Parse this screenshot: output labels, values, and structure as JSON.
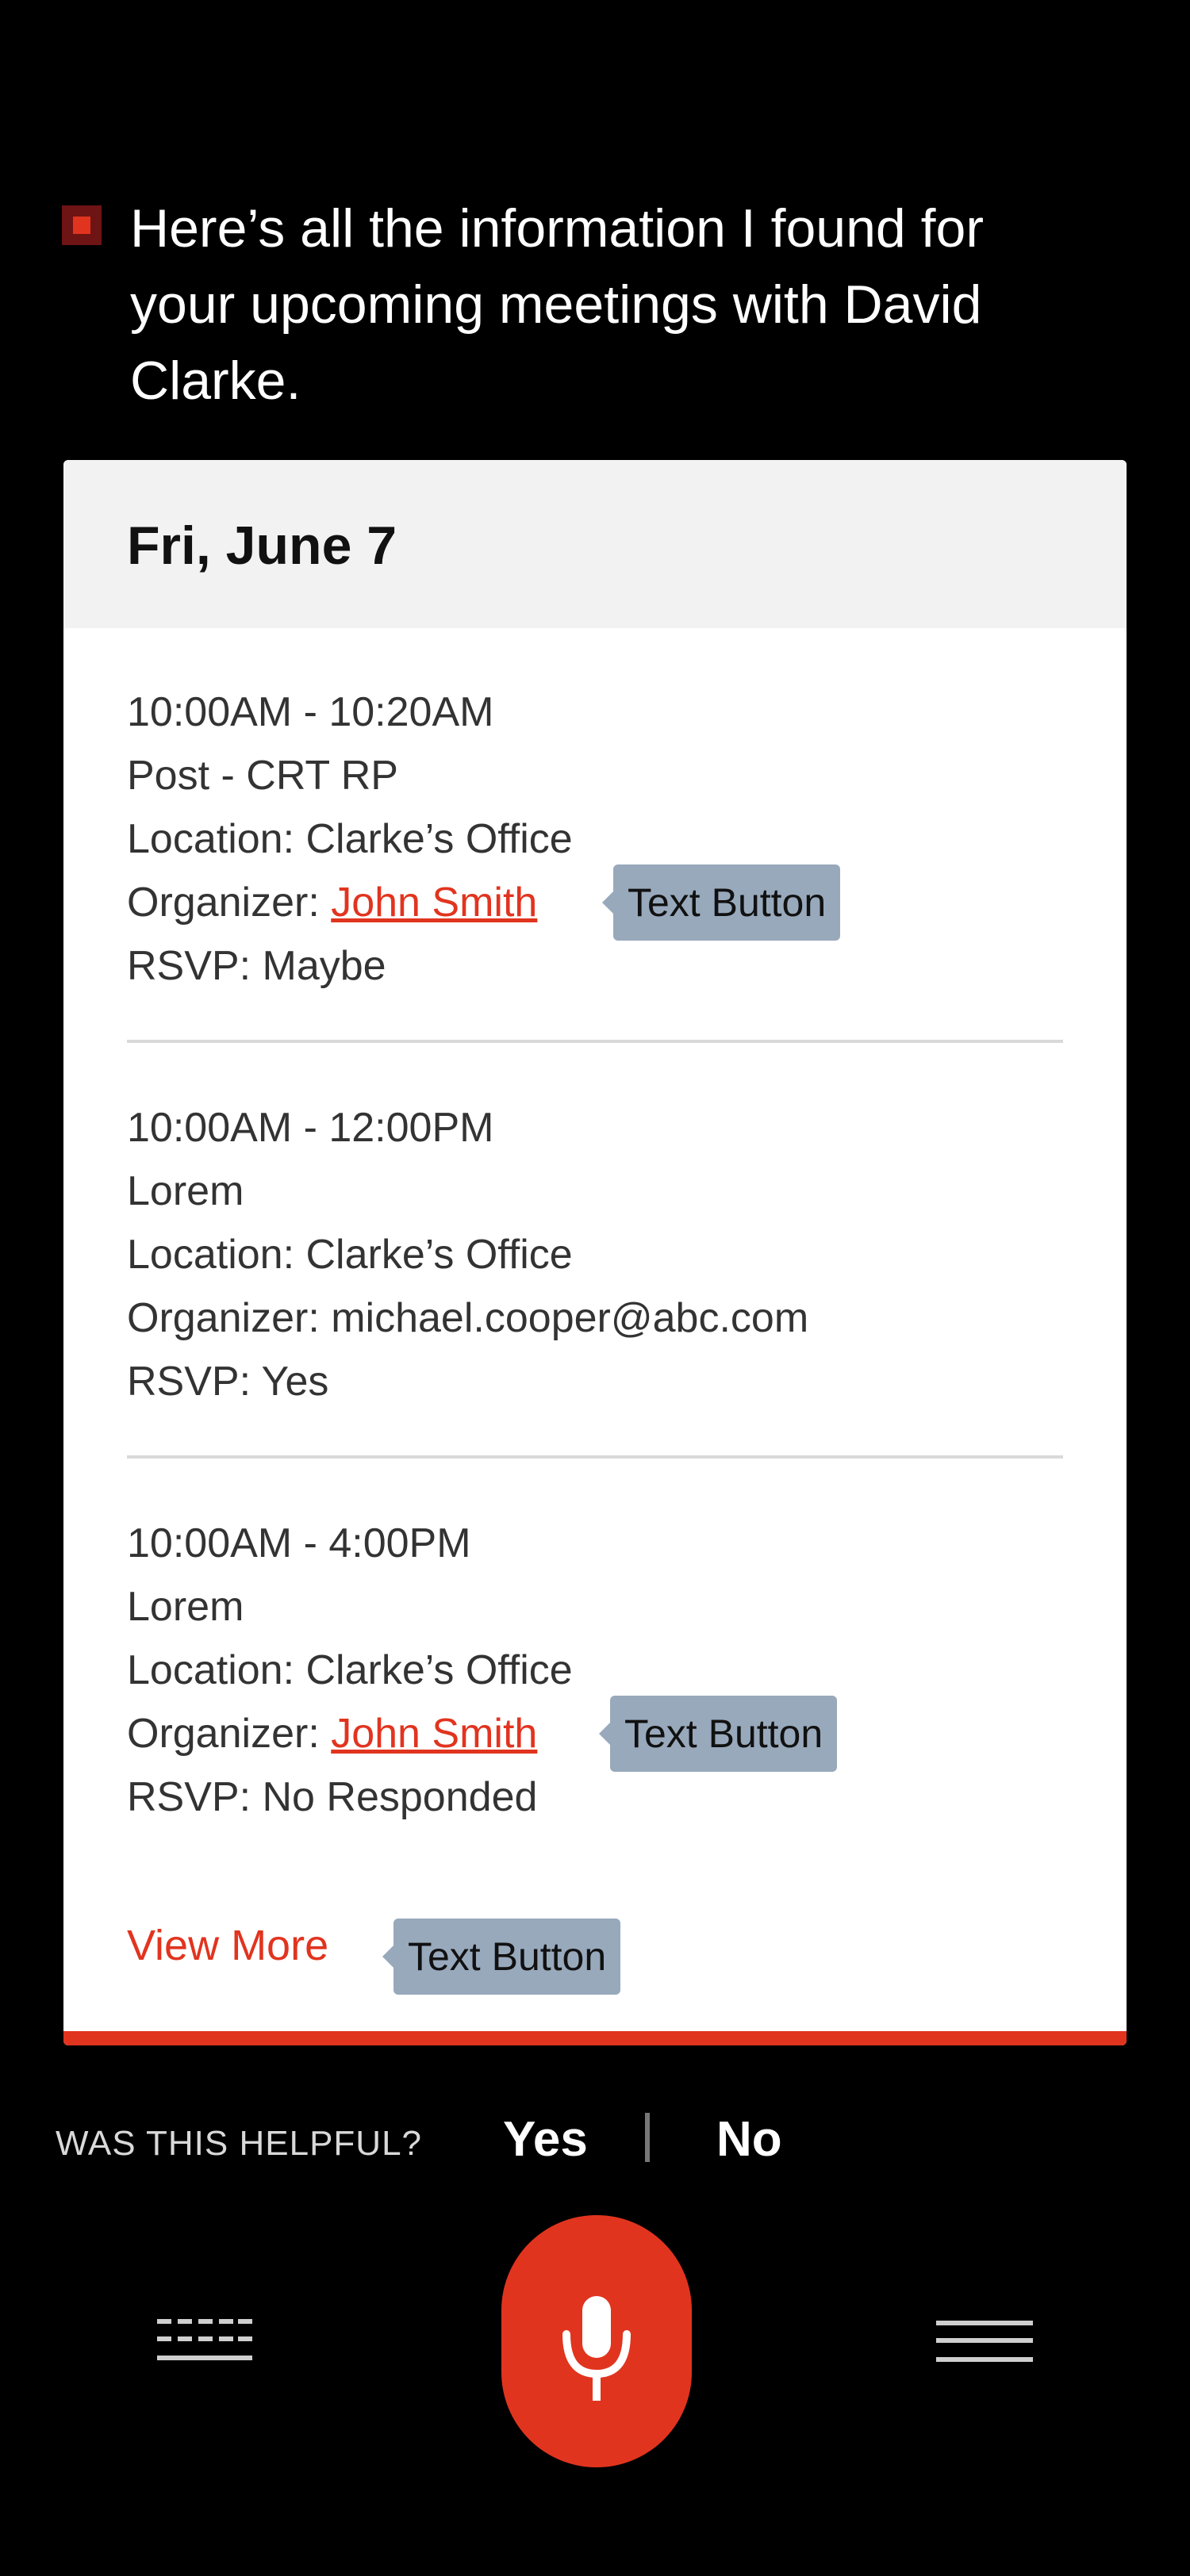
{
  "assistant": {
    "message": "Here’s all the information I found for your upcoming meetings with David Clarke."
  },
  "card": {
    "date": "Fri, June 7",
    "meetings": [
      {
        "time": "10:00AM - 10:20AM",
        "title": "Post - CRT RP",
        "location": "Location: Clarke’s Office",
        "organizer_prefix": "Organizer: ",
        "organizer": "John Smith",
        "rsvp": "RSVP: Maybe",
        "tooltip": "Text Button"
      },
      {
        "time": "10:00AM - 12:00PM",
        "title": "Lorem",
        "location": "Location: Clarke’s Office",
        "organizer_prefix": "Organizer: ",
        "organizer": "michael.cooper@abc.com",
        "rsvp": "RSVP: Yes"
      },
      {
        "time": "10:00AM - 4:00PM",
        "title": "Lorem",
        "location": "Location: Clarke’s Office",
        "organizer_prefix": "Organizer: ",
        "organizer": "John Smith",
        "rsvp": "RSVP: No Responded",
        "tooltip": "Text Button"
      }
    ],
    "view_more": "View More",
    "view_more_tooltip": "Text Button"
  },
  "feedback": {
    "label": "WAS THIS HELPFUL?",
    "yes": "Yes",
    "no": "No"
  },
  "icons": {
    "assistant": "assistant-square-icon",
    "mic": "microphone-icon",
    "keyboard": "keyboard-icon",
    "menu": "menu-icon"
  },
  "colors": {
    "accent": "#e1341f",
    "background": "#000000",
    "card": "#ffffff",
    "card_header": "#f2f2f2",
    "tooltip": "#98a9bc"
  }
}
